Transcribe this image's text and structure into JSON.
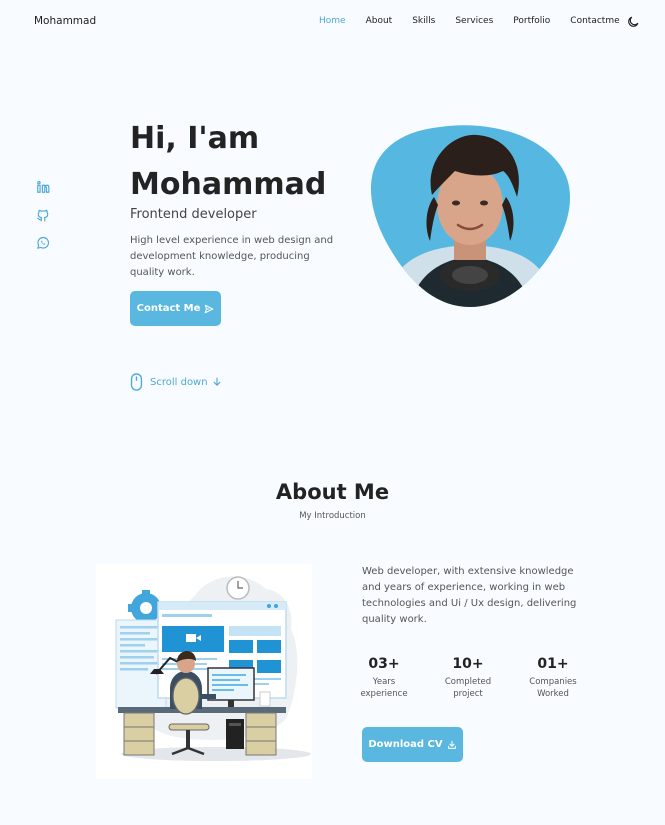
{
  "header": {
    "logo": "Mohammad",
    "nav": [
      "Home",
      "About",
      "Skills",
      "Services",
      "Portfolio",
      "Contactme"
    ],
    "theme_icon": "moon-icon"
  },
  "social": {
    "icons": [
      "linkedin-icon",
      "github-icon",
      "whatsapp-icon"
    ]
  },
  "hero": {
    "greeting": "Hi, I'am",
    "name": "Mohammad",
    "subtitle": "Frontend developer",
    "description": "High level experience in web design and development knowledge, producing quality work.",
    "contact_button": "Contact Me",
    "contact_icon": "send-icon"
  },
  "scroll": {
    "label": "Scroll down",
    "icon": "mouse-icon"
  },
  "about": {
    "title": "About Me",
    "subtitle": "My Introduction",
    "description": "Web developer, with extensive knowledge and years of experience, working in web technologies and Ui / Ux design, delivering quality work.",
    "stats": [
      {
        "num": "03+",
        "line1": "Years",
        "line2": "experience"
      },
      {
        "num": "10+",
        "line1": "Completed",
        "line2": "project"
      },
      {
        "num": "01+",
        "line1": "Companies",
        "line2": "Worked"
      }
    ],
    "cv_button": "Download CV",
    "cv_icon": "download-icon"
  },
  "colors": {
    "accent": "#5ab7df",
    "background": "#f8fbff",
    "text": "#232323"
  }
}
